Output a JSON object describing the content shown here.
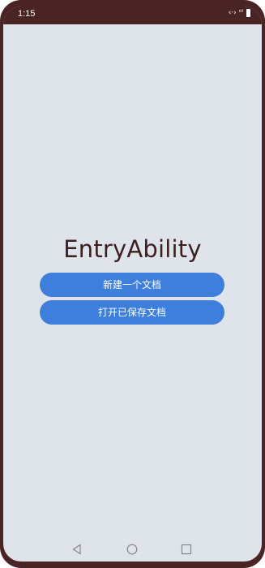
{
  "status_bar": {
    "time": "1:15",
    "icons": [
      "data-transfer-icon",
      "signal-icon",
      "battery-icon"
    ],
    "signal_text": "‹·› ᵒᴵ"
  },
  "main": {
    "title": "EntryAbility",
    "buttons": [
      {
        "label": "新建一个文档"
      },
      {
        "label": "打开已保存文档"
      }
    ]
  },
  "nav_bar": {
    "icons": [
      "back-triangle-icon",
      "home-circle-icon",
      "recents-square-icon"
    ]
  },
  "colors": {
    "frame": "#4a2325",
    "background": "#dfe3ea",
    "button": "#3d7fdb",
    "title": "#3c2020"
  }
}
